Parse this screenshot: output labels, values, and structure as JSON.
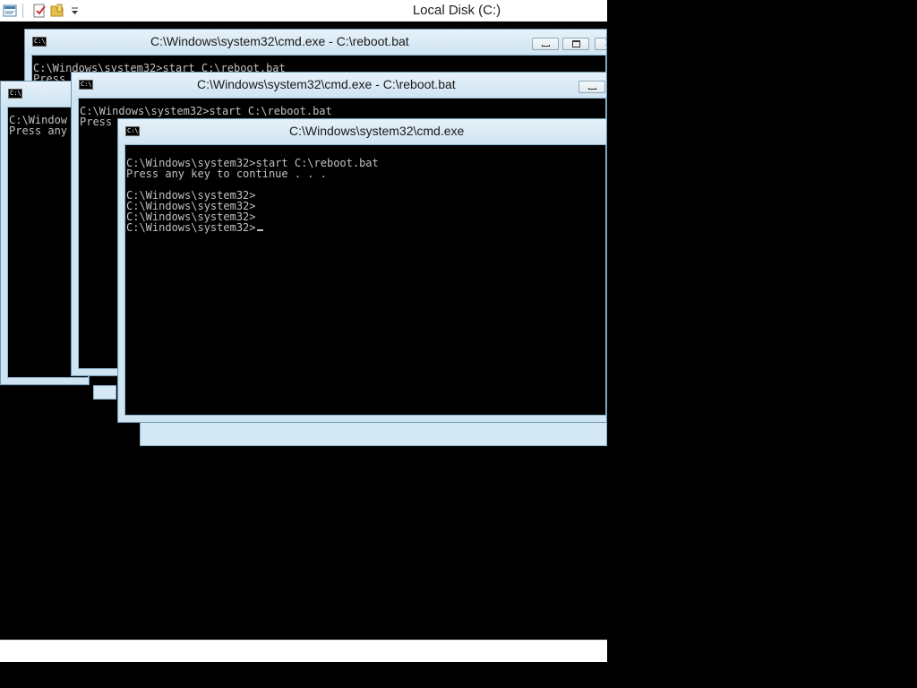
{
  "explorer": {
    "title": "Local Disk (C:)",
    "qat_icons": [
      "properties-icon",
      "new-folder-icon",
      "customize-dropdown-icon"
    ]
  },
  "windows": {
    "cmd1": {
      "title": "C:\\Windows\\system32\\cmd.exe - C:\\reboot.bat",
      "text": "C:\\Windows\\system32>start C:\\reboot.bat\nPress"
    },
    "cmd2": {
      "title": "C:\\Windows\\system32\\cmd.exe - C:\\reboot.bat",
      "text": "C:\\Windows\\system32>start C:\\reboot.bat\nPress"
    },
    "cmd3": {
      "title": "",
      "text": "C:\\Window\nPress any"
    },
    "cmd4": {
      "title": "C:\\Windows\\system32\\cmd.exe",
      "lines": [
        "C:\\Windows\\system32>start C:\\reboot.bat",
        "Press any key to continue . . .",
        "",
        "C:\\Windows\\system32>",
        "C:\\Windows\\system32>",
        "C:\\Windows\\system32>",
        "C:\\Windows\\system32>"
      ]
    }
  },
  "colors": {
    "console_background": "#000000",
    "console_text": "#c0c0c0",
    "window_frame": "#cfe4f2"
  }
}
